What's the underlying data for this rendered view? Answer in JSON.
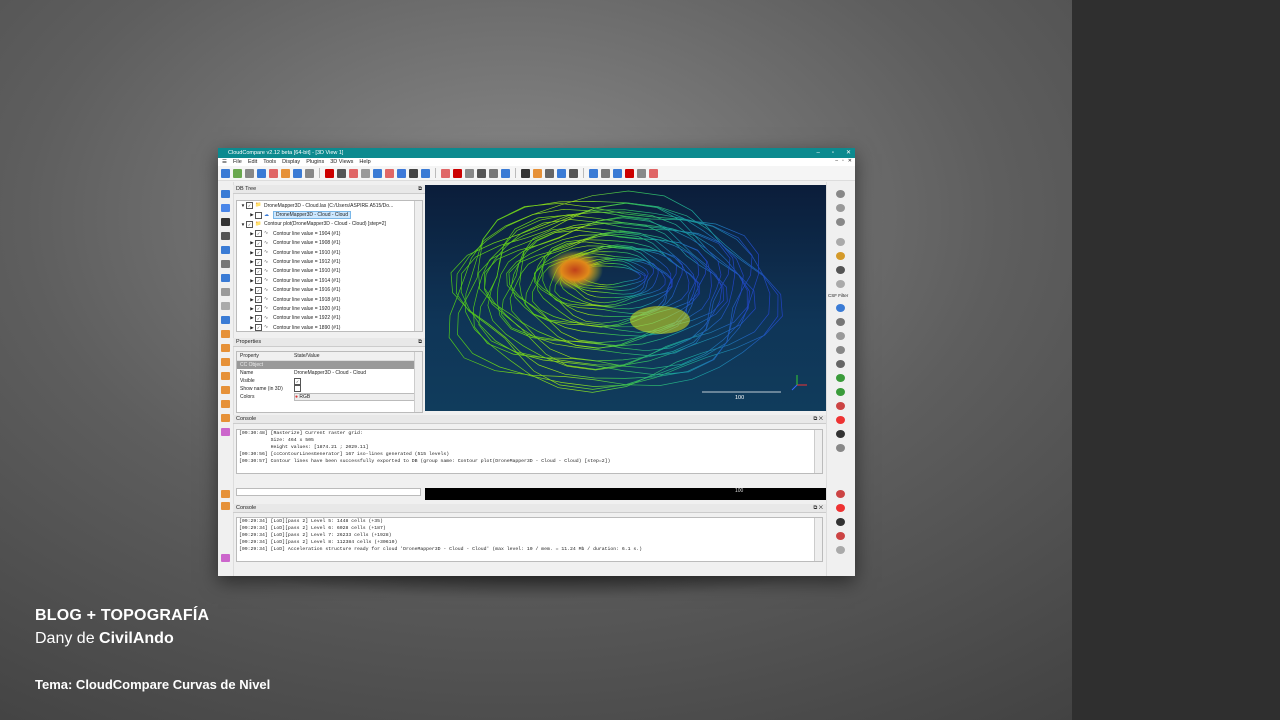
{
  "window": {
    "title": "CloudCompare v2.12 beta [64-bit] - [3D View 1]",
    "menu": [
      "File",
      "Edit",
      "Tools",
      "Display",
      "Plugins",
      "3D Views",
      "Help"
    ]
  },
  "db_tree": {
    "header": "DB Tree",
    "items": [
      {
        "label": "DroneMapper3D - Cloud.las (C:/Users/ASPIRE A515/Do...",
        "indent": 0,
        "selected": false,
        "expanded": true
      },
      {
        "label": "DroneMapper3D - Cloud - Cloud",
        "indent": 1,
        "selected": true,
        "expanded": false
      },
      {
        "label": "Contour plot(DroneMapper3D - Cloud - Cloud) [step=2]",
        "indent": 0,
        "selected": false,
        "expanded": true
      },
      {
        "label": "Contour line value = 1904 (#1)",
        "indent": 1
      },
      {
        "label": "Contour line value = 1908 (#1)",
        "indent": 1
      },
      {
        "label": "Contour line value = 1910 (#1)",
        "indent": 1
      },
      {
        "label": "Contour line value = 1912 (#1)",
        "indent": 1
      },
      {
        "label": "Contour line value = 1910 (#1)",
        "indent": 1
      },
      {
        "label": "Contour line value = 1914 (#1)",
        "indent": 1
      },
      {
        "label": "Contour line value = 1916 (#1)",
        "indent": 1
      },
      {
        "label": "Contour line value = 1918 (#1)",
        "indent": 1
      },
      {
        "label": "Contour line value = 1920 (#1)",
        "indent": 1
      },
      {
        "label": "Contour line value = 1922 (#1)",
        "indent": 1
      },
      {
        "label": "Contour line value = 1890 (#1)",
        "indent": 1
      }
    ]
  },
  "properties": {
    "header": "Properties",
    "col1": "Property",
    "col2": "State/Value",
    "group": "CC Object",
    "rows": [
      {
        "name": "Name",
        "value": "DroneMapper3D - Cloud - Cloud"
      },
      {
        "name": "Visible",
        "value": ""
      },
      {
        "name": "Show name (in 3D)",
        "value": ""
      },
      {
        "name": "Colors",
        "value": "RGB"
      }
    ]
  },
  "view3d": {
    "scale_label": "100",
    "scale_label_2": "100"
  },
  "console1": {
    "header": "Console",
    "lines": [
      "[09:30:48] [Rasterize] Current raster grid:",
      "           Size: 464 x 505",
      "           Height values: [1874.21 ; 2029.11]",
      "[09:30:56] [ccContourLinesGenerator] 167 iso-lines generated (515 levels)",
      "[09:30:57] Contour lines have been successfully exported to DB (group name: Contour plot(DroneMapper3D - Cloud - Cloud) [step=2])"
    ]
  },
  "console2": {
    "header": "Console",
    "lines": [
      "[09:29:34] [LoD][pass 2] Level 5: 1448 cells (+35)",
      "[09:29:34] [LoD][pass 2] Level 6: 6028 cells (+187)",
      "[09:29:34] [LoD][pass 2] Level 7: 26233 cells (+1928)",
      "[09:29:34] [LoD][pass 2] Level 8: 112384 cells (+30610)",
      "[09:29:34] [LoD] Acceleration structure ready for cloud 'DroneMapper3D - Cloud - Cloud' (max level: 10 / mem. = 11.24 Mb / duration: 6.1 s.)"
    ]
  },
  "rightbar_label": "CSF Filter",
  "caption": {
    "title": "BLOG + TOPOGRAFÍA",
    "author_prefix": "Dany de ",
    "author_name": "CivilAndo",
    "topic": "Tema: CloudCompare Curvas de Nivel"
  }
}
